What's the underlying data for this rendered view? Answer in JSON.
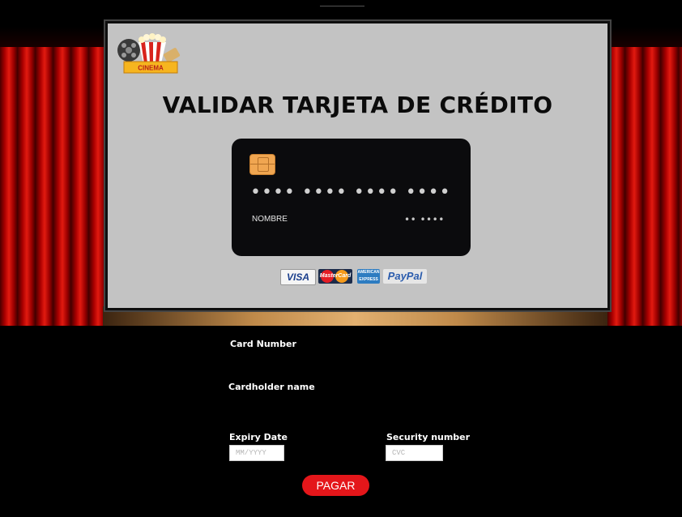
{
  "screen": {
    "title": "VALIDAR TARJETA DE CRÉDITO",
    "logo_text": "CINEMA"
  },
  "card": {
    "number_mask": "•••• •••• •••• ••••",
    "name_label": "NOMBRE",
    "expiry_mask": "•• ••••"
  },
  "payments": {
    "visa": "VISA",
    "mastercard": "MasterCard",
    "amex": "AMERICAN EXPRESS",
    "paypal": "PayPal"
  },
  "form": {
    "card_number_label": "Card Number",
    "cardholder_label": "Cardholder name",
    "expiry_label": "Expiry Date",
    "expiry_placeholder": "MM/YYYY",
    "security_label": "Security number",
    "security_placeholder": "CVC",
    "submit_label": "PAGAR"
  },
  "colors": {
    "background": "#000000",
    "screen": "#c3c3c3",
    "card": "#0b0b0d",
    "chip": "#f0a651",
    "button": "#e4161a",
    "curtain": "#c8120a"
  }
}
